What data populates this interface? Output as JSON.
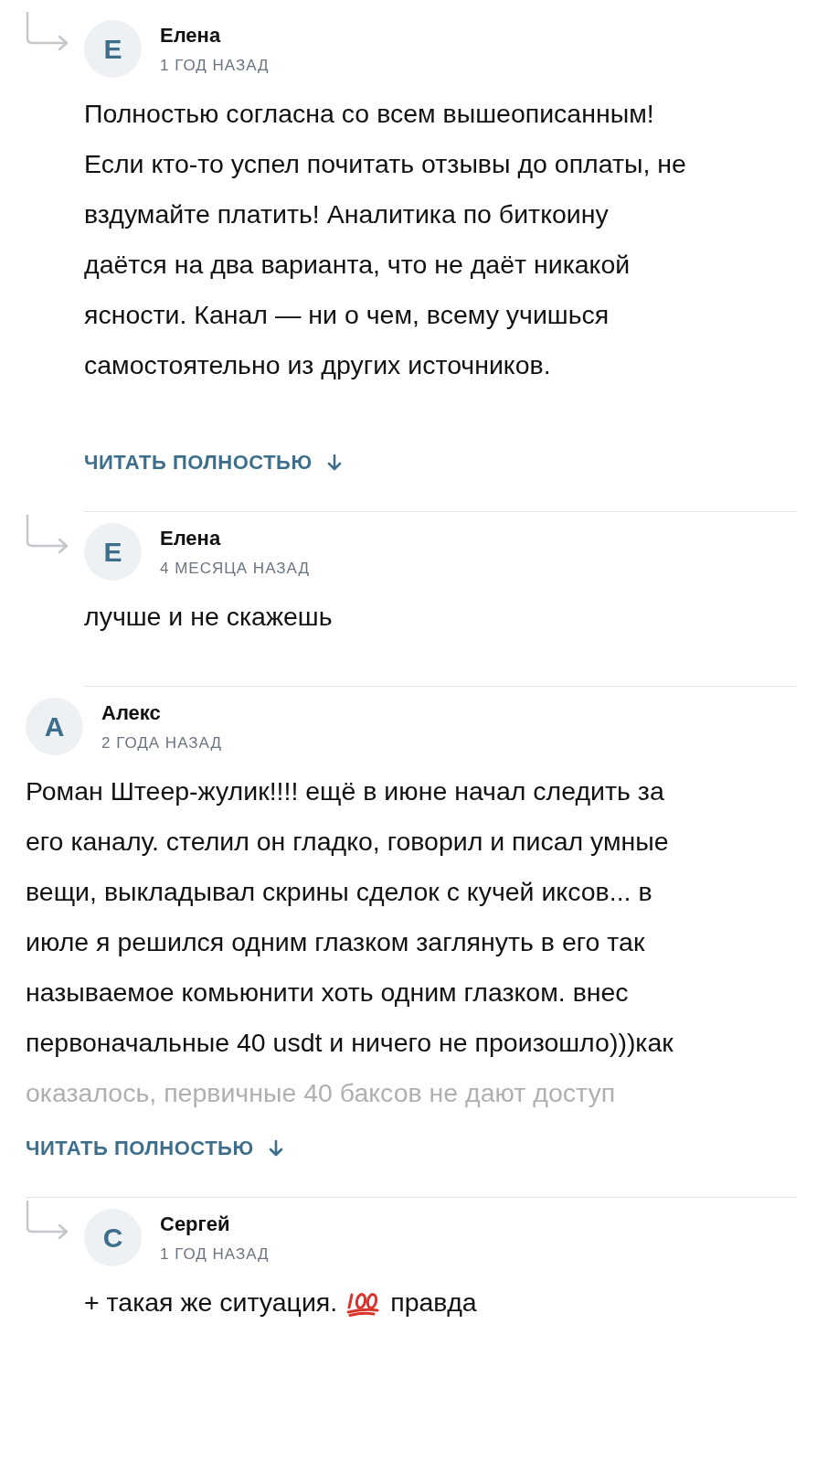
{
  "comments": [
    {
      "kind": "reply",
      "initial": "Е",
      "author": "Елена",
      "time": "1 ГОД НАЗАД",
      "lines": [
        {
          "faded": false,
          "segments": [
            {
              "kind": "text",
              "text": "Полностью согласна со всем вышеописанным!"
            }
          ]
        },
        {
          "faded": false,
          "segments": [
            {
              "kind": "text",
              "text": "Если кто-то успел почитать отзывы до оплаты, не"
            }
          ]
        },
        {
          "faded": false,
          "segments": [
            {
              "kind": "text",
              "text": "вздумайте платить! Аналитика по биткоину"
            }
          ]
        },
        {
          "faded": false,
          "segments": [
            {
              "kind": "text",
              "text": "даётся на два варианта, что не даёт никакой"
            }
          ]
        },
        {
          "faded": false,
          "segments": [
            {
              "kind": "text",
              "text": "ясности. Канал — ни о чем, всему учишься"
            }
          ]
        },
        {
          "faded": false,
          "segments": [
            {
              "kind": "text",
              "text": "самостоятельно из других источников."
            }
          ]
        }
      ],
      "read_more": "ЧИТАТЬ ПОЛНОСТЬЮ"
    },
    {
      "kind": "reply",
      "initial": "Е",
      "author": "Елена",
      "time": "4 МЕСЯЦА НАЗАД",
      "lines": [
        {
          "faded": false,
          "segments": [
            {
              "kind": "text",
              "text": "лучше и не скажешь"
            }
          ]
        }
      ]
    },
    {
      "kind": "top",
      "initial": "А",
      "author": "Алекс",
      "time": "2 ГОДА НАЗАД",
      "lines": [
        {
          "faded": false,
          "segments": [
            {
              "kind": "text",
              "text": "Роман Штеер-жулик!!!! ещё в июне начал следить за"
            }
          ]
        },
        {
          "faded": false,
          "segments": [
            {
              "kind": "text",
              "text": "его каналу. стелил он гладко, говорил и писал умные"
            }
          ]
        },
        {
          "faded": false,
          "segments": [
            {
              "kind": "text",
              "text": "вещи, выкладывал скрины сделок с кучей иксов... в"
            }
          ]
        },
        {
          "faded": false,
          "segments": [
            {
              "kind": "text",
              "text": "июле я решился одним глазком заглянуть в его так"
            }
          ]
        },
        {
          "faded": false,
          "segments": [
            {
              "kind": "text",
              "text": "называемое комьюнити хоть одним глазком. внес"
            }
          ]
        },
        {
          "faded": false,
          "segments": [
            {
              "kind": "text",
              "text": "первоначальные 40 usdt и ничего не произошло)))как"
            }
          ]
        },
        {
          "faded": true,
          "segments": [
            {
              "kind": "text",
              "text": "оказалось, первичные 40 баксов не дают доступ"
            }
          ]
        }
      ],
      "read_more": "ЧИТАТЬ ПОЛНОСТЬЮ"
    },
    {
      "kind": "reply",
      "initial": "С",
      "author": "Сергей",
      "time": "1 ГОД НАЗАД",
      "lines": [
        {
          "faded": false,
          "segments": [
            {
              "kind": "text",
              "text": "+ такая же ситуация."
            },
            {
              "kind": "emoji"
            },
            {
              "kind": "text",
              "text": "правда"
            }
          ]
        }
      ]
    }
  ]
}
